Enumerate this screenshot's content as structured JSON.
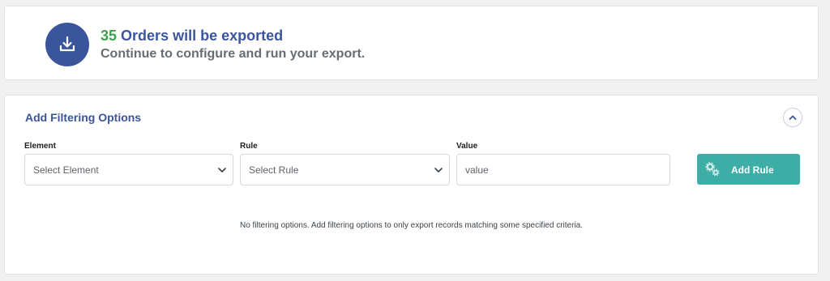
{
  "export_summary": {
    "count": "35",
    "title_suffix": "Orders will be exported",
    "subtitle": "Continue to configure and run your export.",
    "icon": "download-icon"
  },
  "filter": {
    "title": "Add Filtering Options",
    "collapse_icon": "chevron-up-icon",
    "element_label": "Element",
    "element_value": "Select Element",
    "rule_label": "Rule",
    "rule_value": "Select Rule",
    "value_label": "Value",
    "value_placeholder": "value",
    "add_rule_label": "Add Rule",
    "add_rule_icon": "gears-icon",
    "empty_message": "No filtering options. Add filtering options to only export records matching some specified criteria."
  },
  "colors": {
    "brand_blue": "#3a559b",
    "count_green": "#3aa24a",
    "button_teal": "#3daea6"
  }
}
